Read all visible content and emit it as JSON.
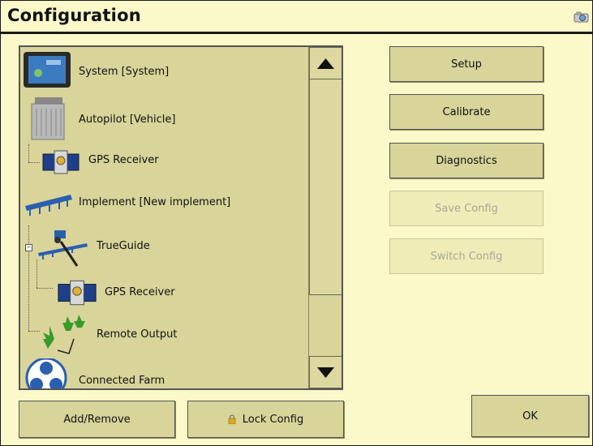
{
  "window": {
    "title": "Configuration"
  },
  "list": {
    "items": [
      {
        "label": "System [System]",
        "icon": "display-icon"
      },
      {
        "label": "Autopilot [Vehicle]",
        "icon": "controller-box-icon"
      },
      {
        "label": "GPS Receiver",
        "icon": "satellite-icon"
      },
      {
        "label": "Implement [New implement]",
        "icon": "implement-icon"
      },
      {
        "label": "TrueGuide",
        "icon": "trueguide-icon"
      },
      {
        "label": "GPS Receiver",
        "icon": "satellite-icon"
      },
      {
        "label": "Remote Output",
        "icon": "trees-icon"
      },
      {
        "label": "Connected Farm",
        "icon": "connected-farm-icon"
      }
    ]
  },
  "buttons": {
    "setup": "Setup",
    "calibrate": "Calibrate",
    "diagnostics": "Diagnostics",
    "save_config": "Save Config",
    "switch_config": "Switch Config",
    "add_remove": "Add/Remove",
    "lock_config": "Lock Config",
    "ok": "OK"
  },
  "states": {
    "save_config_enabled": false,
    "switch_config_enabled": false
  },
  "colors": {
    "background": "#fbf8c9",
    "panel": "#d8d49a",
    "disabled_text": "#aaa694"
  }
}
